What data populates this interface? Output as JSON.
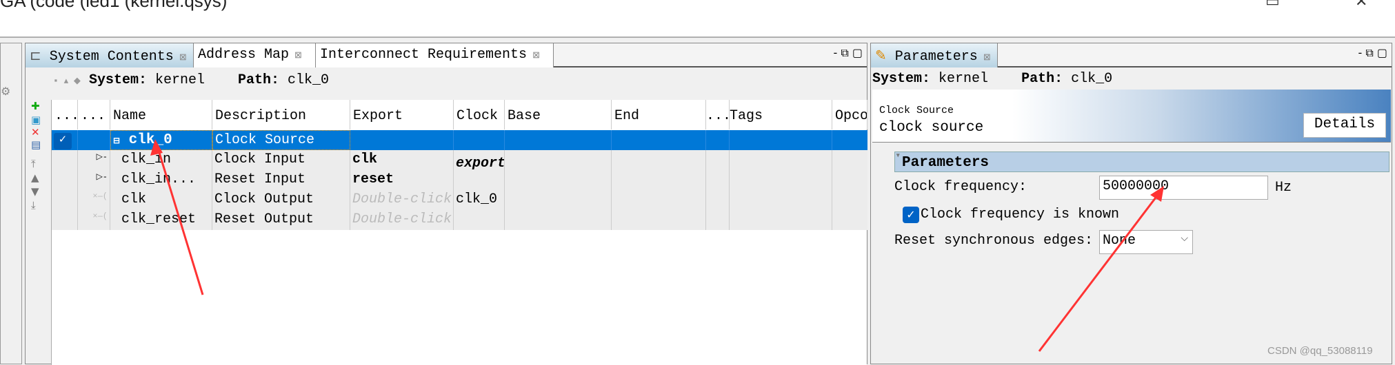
{
  "window": {
    "title": "GA (code (led1 (kernel.qsys)",
    "minimize": "▭",
    "close": "✕"
  },
  "system_contents": {
    "tabs": [
      {
        "label": "System Contents",
        "active": true
      },
      {
        "label": "Address Map"
      },
      {
        "label": "Interconnect Requirements"
      }
    ],
    "tab_close": "⊠",
    "system_label": "System:",
    "system_value": "kernel",
    "path_label": "Path:",
    "path_value": "clk_0",
    "columns": [
      "......",
      "...",
      "Name",
      "Description",
      "Export",
      "Clock",
      "Base",
      "End",
      "...",
      "Tags",
      "Opcode"
    ],
    "rows": [
      {
        "name": "clk_0",
        "description": "Clock Source",
        "export": "",
        "clock": "",
        "selected": true,
        "expander": "⊟"
      },
      {
        "name": "clk_in",
        "description": "Clock Input",
        "export": "clk",
        "clock": "export"
      },
      {
        "name": "clk_in...",
        "description": "Reset Input",
        "export": "reset",
        "clock": ""
      },
      {
        "name": "clk",
        "description": "Clock Output",
        "export": "Double-click",
        "clock": "clk_0"
      },
      {
        "name": "clk_reset",
        "description": "Reset Output",
        "export": "Double-click",
        "clock": ""
      }
    ],
    "check_mark": "✓"
  },
  "parameters": {
    "tab_label": "Parameters",
    "system_label": "System:",
    "system_value": "kernel",
    "path_label": "Path:",
    "path_value": "clk_0",
    "component_type": "Clock Source",
    "component_desc": "clock source",
    "details_button": "Details",
    "group_title": "Parameters",
    "clock_frequency_label": "Clock frequency:",
    "clock_frequency_value": "50000000",
    "clock_frequency_unit": "Hz",
    "freq_known_label": "Clock frequency is known",
    "freq_known_checked": true,
    "reset_edges_label": "Reset synchronous edges:",
    "reset_edges_value": "None"
  },
  "watermark": "CSDN @qq_53088119",
  "colors": {
    "selection": "#0078d7",
    "annotation_arrow": "#ff3333",
    "group_header": "#b8cfe6"
  }
}
